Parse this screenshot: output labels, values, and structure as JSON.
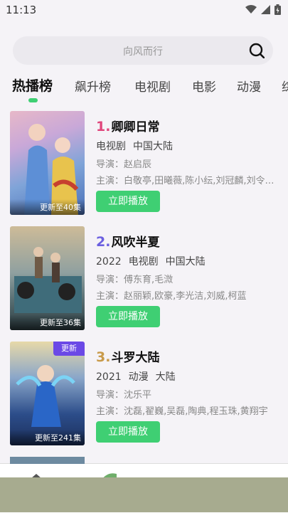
{
  "status": {
    "time": "11:13"
  },
  "search": {
    "placeholder": "向风而行"
  },
  "tabs": [
    {
      "label": "热播榜"
    },
    {
      "label": "飙升榜"
    },
    {
      "label": "电视剧"
    },
    {
      "label": "电影"
    },
    {
      "label": "动漫"
    },
    {
      "label": "综"
    }
  ],
  "items": [
    {
      "rank": "1.",
      "rank_color": "#e0457b",
      "title": "卿卿日常",
      "year": "",
      "type": "电视剧",
      "region": "中国大陆",
      "director": "导演：赵启辰",
      "cast": "主演：白敬亭,田曦薇,陈小纭,刘冠麟,刘令…",
      "episode": "更新至40集",
      "badge": "",
      "play": "立即播放"
    },
    {
      "rank": "2.",
      "rank_color": "#6b5fe0",
      "title": "风吹半夏",
      "year": "2022",
      "type": "电视剧",
      "region": "中国大陆",
      "director": "导演：傅东育,毛溦",
      "cast": "主演：赵丽颖,欧豪,李光洁,刘威,柯蓝",
      "episode": "更新至36集",
      "badge": "",
      "play": "立即播放"
    },
    {
      "rank": "3.",
      "rank_color": "#c89a4a",
      "title": "斗罗大陆",
      "year": "2021",
      "type": "动漫",
      "region": "大陆",
      "director": "导演：沈乐平",
      "cast": "主演：沈磊,翟巍,吴磊,陶典,程玉珠,黄翔宇",
      "episode": "更新至241集",
      "badge": "更新",
      "play": "立即播放"
    }
  ]
}
